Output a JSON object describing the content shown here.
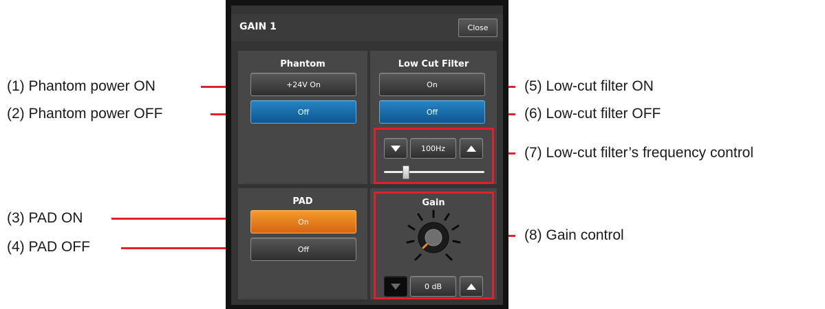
{
  "window": {
    "title": "GAIN 1",
    "close_label": "Close"
  },
  "phantom": {
    "title": "Phantom",
    "on_label": "+24V On",
    "off_label": "Off",
    "selected": "Off"
  },
  "pad": {
    "title": "PAD",
    "on_label": "On",
    "off_label": "Off",
    "selected": "On"
  },
  "lowcut": {
    "title": "Low Cut Filter",
    "on_label": "On",
    "off_label": "Off",
    "selected": "Off",
    "frequency_label": "100Hz",
    "slider_fraction": 0.22
  },
  "gain": {
    "title": "Gain",
    "value_label": "0 dB",
    "knob_fraction": 0.0
  },
  "callouts": [
    "(1) Phantom power ON",
    "(2) Phantom power OFF",
    "(3) PAD ON",
    "(4) PAD OFF",
    "(5) Low-cut filter ON",
    "(6) Low-cut filter OFF",
    "(7) Low-cut filter’s frequency control",
    "(8) Gain control"
  ],
  "colors": {
    "callout_red": "#e2202c",
    "selected_blue": "#1668a8",
    "pad_orange": "#e77a1c",
    "knob_indicator": "#f08a24"
  },
  "icons": {
    "down": "triangle-down-icon",
    "up": "triangle-up-icon",
    "knob": "gain-knob-icon"
  }
}
